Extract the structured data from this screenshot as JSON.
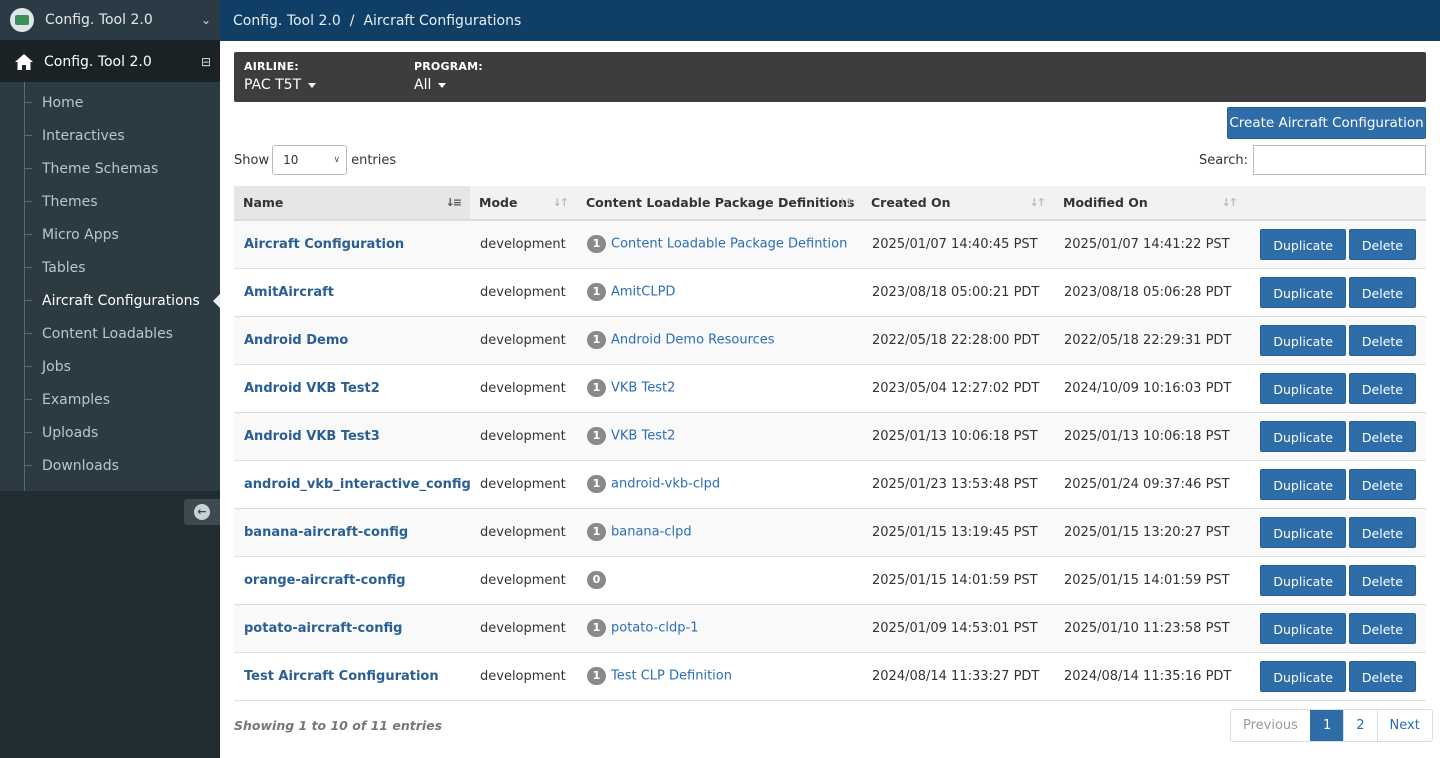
{
  "app_select": {
    "label": "Config. Tool 2.0"
  },
  "nav": {
    "head": "Config. Tool 2.0",
    "items": [
      {
        "label": "Home"
      },
      {
        "label": "Interactives"
      },
      {
        "label": "Theme Schemas"
      },
      {
        "label": "Themes"
      },
      {
        "label": "Micro Apps"
      },
      {
        "label": "Tables"
      },
      {
        "label": "Aircraft Configurations"
      },
      {
        "label": "Content Loadables"
      },
      {
        "label": "Jobs"
      },
      {
        "label": "Examples"
      },
      {
        "label": "Uploads"
      },
      {
        "label": "Downloads"
      }
    ],
    "active_index": 6
  },
  "breadcrumb": {
    "root": "Config. Tool 2.0",
    "separator": "/",
    "current": "Aircraft Configurations"
  },
  "filters": {
    "airline": {
      "label": "AIRLINE:",
      "value": "PAC T5T"
    },
    "program": {
      "label": "PROGRAM:",
      "value": "All"
    }
  },
  "create_button": "Create Aircraft Configuration",
  "length_menu": {
    "show": "Show",
    "value": "10",
    "entries": "entries"
  },
  "search": {
    "label": "Search:",
    "value": ""
  },
  "table": {
    "headers": [
      "Name",
      "Mode",
      "Content Loadable Package Definitions",
      "Created On",
      "Modified On"
    ],
    "duplicate_label": "Duplicate",
    "delete_label": "Delete",
    "rows": [
      {
        "name": "Aircraft Configuration",
        "mode": "development",
        "count": "1",
        "clp": "Content Loadable Package Defintion",
        "created": "2025/01/07 14:40:45 PST",
        "modified": "2025/01/07 14:41:22 PST"
      },
      {
        "name": "AmitAircraft",
        "mode": "development",
        "count": "1",
        "clp": "AmitCLPD",
        "created": "2023/08/18 05:00:21 PDT",
        "modified": "2023/08/18 05:06:28 PDT"
      },
      {
        "name": "Android Demo",
        "mode": "development",
        "count": "1",
        "clp": "Android Demo Resources",
        "created": "2022/05/18 22:28:00 PDT",
        "modified": "2022/05/18 22:29:31 PDT"
      },
      {
        "name": "Android VKB Test2",
        "mode": "development",
        "count": "1",
        "clp": "VKB Test2",
        "created": "2023/05/04 12:27:02 PDT",
        "modified": "2024/10/09 10:16:03 PDT"
      },
      {
        "name": "Android VKB Test3",
        "mode": "development",
        "count": "1",
        "clp": "VKB Test2",
        "created": "2025/01/13 10:06:18 PST",
        "modified": "2025/01/13 10:06:18 PST"
      },
      {
        "name": "android_vkb_interactive_config",
        "mode": "development",
        "count": "1",
        "clp": "android-vkb-clpd",
        "created": "2025/01/23 13:53:48 PST",
        "modified": "2025/01/24 09:37:46 PST"
      },
      {
        "name": "banana-aircraft-config",
        "mode": "development",
        "count": "1",
        "clp": "banana-clpd",
        "created": "2025/01/15 13:19:45 PST",
        "modified": "2025/01/15 13:20:27 PST"
      },
      {
        "name": "orange-aircraft-config",
        "mode": "development",
        "count": "0",
        "clp": "",
        "created": "2025/01/15 14:01:59 PST",
        "modified": "2025/01/15 14:01:59 PST"
      },
      {
        "name": "potato-aircraft-config",
        "mode": "development",
        "count": "1",
        "clp": "potato-cldp-1",
        "created": "2025/01/09 14:53:01 PST",
        "modified": "2025/01/10 11:23:58 PST"
      },
      {
        "name": "Test Aircraft Configuration",
        "mode": "development",
        "count": "1",
        "clp": "Test CLP Definition",
        "created": "2024/08/14 11:33:27 PDT",
        "modified": "2024/08/14 11:35:16 PDT"
      }
    ]
  },
  "info": "Showing 1 to 10 of 11 entries",
  "pagination": {
    "previous": "Previous",
    "pages": [
      "1",
      "2"
    ],
    "current": "1",
    "next": "Next"
  },
  "colors": {
    "topbar": "#0f3e66",
    "sidebar": "#222d32",
    "primary": "#2f6da8",
    "filterbar": "#3d3d3d"
  }
}
